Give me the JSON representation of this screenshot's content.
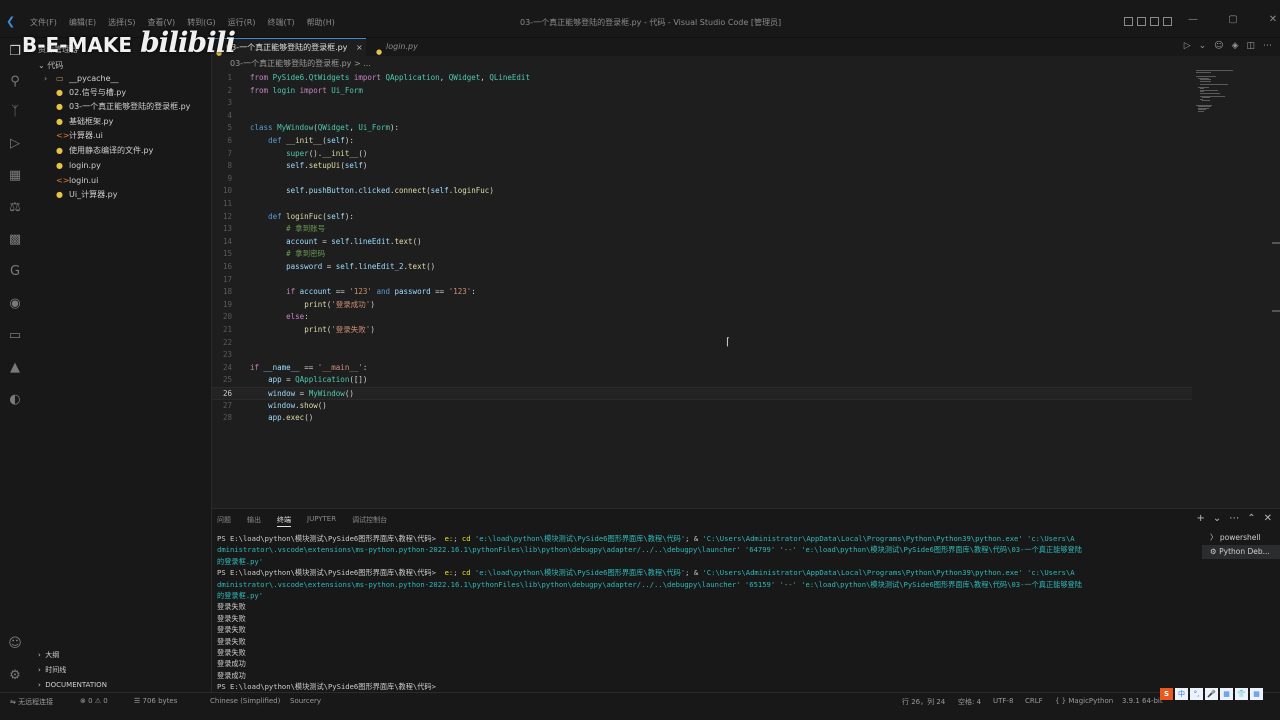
{
  "window": {
    "title": "03-一个真正能够登陆的登录框.py - 代码 - Visual Studio Code [管理员]",
    "menu": [
      "文件(F)",
      "编辑(E)",
      "选择(S)",
      "查看(V)",
      "转到(G)",
      "运行(R)",
      "终端(T)",
      "帮助(H)"
    ]
  },
  "watermark": {
    "brand": "B-E-MAKE",
    "site": "bilibili"
  },
  "sidebar": {
    "header": "资源管理器",
    "root": "代码",
    "items": [
      {
        "label": "__pycache__",
        "type": "folder"
      },
      {
        "label": "02.信号与槽.py",
        "type": "py"
      },
      {
        "label": "03-一个真正能够登陆的登录框.py",
        "type": "py"
      },
      {
        "label": "基础框架.py",
        "type": "py"
      },
      {
        "label": "计算器.ui",
        "type": "ui"
      },
      {
        "label": "使用静态编译的文件.py",
        "type": "py"
      },
      {
        "label": "login.py",
        "type": "py"
      },
      {
        "label": "login.ui",
        "type": "ui"
      },
      {
        "label": "Ui_计算器.py",
        "type": "py"
      }
    ],
    "bottom_sections": [
      "大纲",
      "时间线",
      "DOCUMENTATION"
    ]
  },
  "tabs": [
    {
      "label": "03-一个真正能够登陆的登录框.py",
      "close": "×"
    },
    {
      "label": "login.py"
    }
  ],
  "breadcrumb": "03-一个真正能够登陆的登录框.py > ...",
  "editor": {
    "current_line": 26,
    "lines": [
      {
        "n": 1,
        "html": "<span class='k'>from</span> <span class='cls'>PySide6.QtWidgets</span> <span class='k'>import</span> <span class='cls'>QApplication</span><span class='pl'>, </span><span class='cls'>QWidget</span><span class='pl'>, </span><span class='cls'>QLineEdit</span>"
      },
      {
        "n": 2,
        "html": "<span class='k'>from</span> <span class='cls'>login</span> <span class='k'>import</span> <span class='cls'>Ui_Form</span>"
      },
      {
        "n": 3,
        "html": ""
      },
      {
        "n": 4,
        "html": ""
      },
      {
        "n": 5,
        "html": "<span class='kb'>class</span> <span class='cls'>MyWindow</span><span class='pl'>(</span><span class='cls'>QWidget</span><span class='pl'>, </span><span class='cls'>Ui_Form</span><span class='pl'>):</span>"
      },
      {
        "n": 6,
        "html": "    <span class='kb'>def</span> <span class='fn'>__init__</span><span class='pl'>(</span><span class='sl'>self</span><span class='pl'>):</span>"
      },
      {
        "n": 7,
        "html": "        <span class='cls'>super</span><span class='pl'>().</span><span class='fn'>__init__</span><span class='pl'>()</span>"
      },
      {
        "n": 8,
        "html": "        <span class='sl'>self</span><span class='pl'>.</span><span class='fn'>setupUi</span><span class='pl'>(</span><span class='sl'>self</span><span class='pl'>)</span>"
      },
      {
        "n": 9,
        "html": ""
      },
      {
        "n": 10,
        "html": "        <span class='sl'>self</span><span class='pl'>.</span><span class='sl'>pushButton</span><span class='pl'>.</span><span class='sl'>clicked</span><span class='pl'>.</span><span class='fn'>connect</span><span class='pl'>(</span><span class='sl'>self</span><span class='pl'>.</span><span class='fn'>loginFuc</span><span class='pl'>)</span>"
      },
      {
        "n": 11,
        "html": ""
      },
      {
        "n": 12,
        "html": "    <span class='kb'>def</span> <span class='fn'>loginFuc</span><span class='pl'>(</span><span class='sl'>self</span><span class='pl'>):</span>"
      },
      {
        "n": 13,
        "html": "        <span class='cm'># 拿到账号</span>"
      },
      {
        "n": 14,
        "html": "        <span class='sl'>account</span> <span class='pl'>=</span> <span class='sl'>self</span><span class='pl'>.</span><span class='sl'>lineEdit</span><span class='pl'>.</span><span class='fn'>text</span><span class='pl'>()</span>"
      },
      {
        "n": 15,
        "html": "        <span class='cm'># 拿到密码</span>"
      },
      {
        "n": 16,
        "html": "        <span class='sl'>password</span> <span class='pl'>=</span> <span class='sl'>self</span><span class='pl'>.</span><span class='sl'>lineEdit_2</span><span class='pl'>.</span><span class='fn'>text</span><span class='pl'>()</span>"
      },
      {
        "n": 17,
        "html": ""
      },
      {
        "n": 18,
        "html": "        <span class='k'>if</span> <span class='sl'>account</span> <span class='pl'>==</span> <span class='st'>'123'</span> <span class='kb'>and</span> <span class='sl'>password</span> <span class='pl'>==</span> <span class='st'>'123'</span><span class='pl'>:</span>"
      },
      {
        "n": 19,
        "html": "            <span class='fn'>print</span><span class='pl'>(</span><span class='st'>'登录成功'</span><span class='pl'>)</span>"
      },
      {
        "n": 20,
        "html": "        <span class='k'>else</span><span class='pl'>:</span>"
      },
      {
        "n": 21,
        "html": "            <span class='fn'>print</span><span class='pl'>(</span><span class='st'>'登录失败'</span><span class='pl'>)</span>"
      },
      {
        "n": 22,
        "html": ""
      },
      {
        "n": 23,
        "html": ""
      },
      {
        "n": 24,
        "html": "<span class='k'>if</span> <span class='sl'>__name__</span> <span class='pl'>==</span> <span class='st'>'__main__'</span><span class='pl'>:</span>"
      },
      {
        "n": 25,
        "html": "    <span class='sl'>app</span> <span class='pl'>=</span> <span class='cls'>QApplication</span><span class='pl'>([])</span>"
      },
      {
        "n": 26,
        "html": "    <span class='sl'>window</span> <span class='pl'>=</span> <span class='cls'>MyWindow</span><span class='pl'>()</span>"
      },
      {
        "n": 27,
        "html": "    <span class='sl'>window</span><span class='pl'>.</span><span class='fn'>show</span><span class='pl'>()</span>"
      },
      {
        "n": 28,
        "html": "    <span class='sl'>app</span><span class='pl'>.</span><span class='fn'>exec</span><span class='pl'>()</span>"
      }
    ]
  },
  "panel": {
    "tabs": [
      "问题",
      "输出",
      "终端",
      "JUPYTER",
      "调试控制台"
    ],
    "active_tab": "终端",
    "terminal_lines": [
      "PS E:\\load\\python\\模块测试\\PySide6图形界面库\\教程\\代码>  <span class='y'>e:</span>; <span class='y'>cd</span> <span class='c'>'e:\\load\\python\\模块测试\\PySide6图形界面库\\教程\\代码'</span>; & <span class='c'>'C:\\Users\\Administrator\\AppData\\Local\\Programs\\Python\\Python39\\python.exe' 'c:\\Users\\A</span>",
      "<span class='c'>dministrator\\.vscode\\extensions\\ms-python.python-2022.16.1\\pythonFiles\\lib\\python\\debugpy\\adapter/../..\\debugpy\\launcher' '64799' '--' 'e:\\load\\python\\模块测试\\PySide6图形界面库\\教程\\代码\\03-一个真正能够登陆</span>",
      "<span class='c'>的登录框.py'</span>",
      "PS E:\\load\\python\\模块测试\\PySide6图形界面库\\教程\\代码>  <span class='y'>e:</span>; <span class='y'>cd</span> <span class='c'>'e:\\load\\python\\模块测试\\PySide6图形界面库\\教程\\代码'</span>; & <span class='c'>'C:\\Users\\Administrator\\AppData\\Local\\Programs\\Python\\Python39\\python.exe' 'c:\\Users\\A</span>",
      "<span class='c'>dministrator\\.vscode\\extensions\\ms-python.python-2022.16.1\\pythonFiles\\lib\\python\\debugpy\\adapter/../..\\debugpy\\launcher' '65159' '--' 'e:\\load\\python\\模块测试\\PySide6图形界面库\\教程\\代码\\03-一个真正能够登陆</span>",
      "<span class='c'>的登录框.py'</span>",
      "登录失败",
      "登录失败",
      "登录失败",
      "登录失败",
      "登录失败",
      "登录成功",
      "登录成功",
      "PS E:\\load\\python\\模块测试\\PySide6图形界面库\\教程\\代码> "
    ],
    "terminals": [
      "powershell",
      "Python Deb..."
    ]
  },
  "statusbar": {
    "remote": "无远程连接",
    "problems": "⊗ 0 ⚠ 0",
    "size": "706 bytes",
    "lang_pack": "Chinese (Simplified)",
    "sourcery": "Sourcery",
    "position": "行 26，列 24",
    "spaces": "空格: 4",
    "encoding": "UTF-8",
    "eol": "CRLF",
    "language": "MagicPython",
    "interpreter": "3.9.1 64-bit"
  },
  "ime": [
    "S",
    "中",
    "°,",
    "🎤",
    "▦",
    "👕",
    "▦"
  ],
  "colors": {
    "accent": "#3c8dd6",
    "background": "#1e1e1e",
    "sidebar": "#181818"
  }
}
